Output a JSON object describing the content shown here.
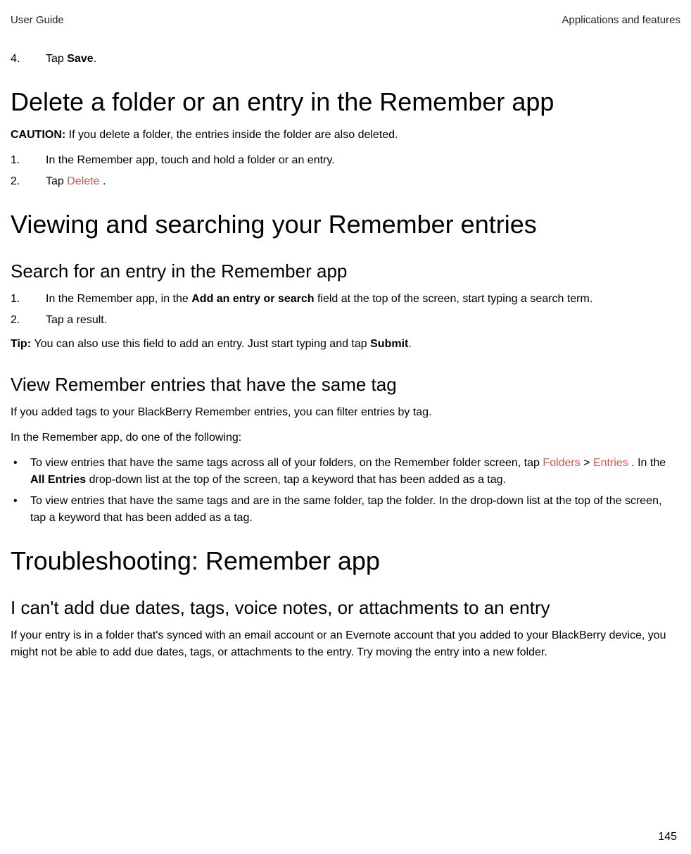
{
  "header": {
    "left": "User Guide",
    "right": "Applications and features"
  },
  "introStep": {
    "num": "4.",
    "prefix": "Tap ",
    "bold": "Save",
    "suffix": "."
  },
  "section1": {
    "h1": "Delete a folder or an entry in the Remember app",
    "cautionLabel": "CAUTION: ",
    "cautionText": "If you delete a folder, the entries inside the folder are also deleted.",
    "steps": [
      {
        "num": "1.",
        "text": "In the Remember app, touch and hold a folder or an entry."
      },
      {
        "num": "2.",
        "prefix": "Tap  ",
        "red": "Delete",
        "suffix": " ."
      }
    ]
  },
  "section2": {
    "h1": "Viewing and searching your Remember entries",
    "sub1": {
      "h2": "Search for an entry in the Remember app",
      "steps": [
        {
          "num": "1.",
          "pre": "In the Remember app, in the ",
          "bold": "Add an entry or search",
          "post": " field at the top of the screen, start typing a search term."
        },
        {
          "num": "2.",
          "text": "Tap a result."
        }
      ],
      "tipLabel": "Tip: ",
      "tipPre": "You can also use this field to add an entry. Just start typing and tap ",
      "tipBold": "Submit",
      "tipPost": "."
    },
    "sub2": {
      "h2": "View Remember entries that have the same tag",
      "p1": "If you added tags to your BlackBerry Remember entries, you can filter entries by tag.",
      "p2": "In the Remember app, do one of the following:",
      "bullets": [
        {
          "pre": "To view entries that have the same tags across all of your folders, on the Remember folder screen, tap  ",
          "red1": "Folders",
          "mid": "  > ",
          "red2": "Entries",
          "post1": " . In the ",
          "bold": "All Entries",
          "post2": " drop-down list at the top of the screen, tap a keyword that has been added as a tag."
        },
        {
          "text": "To view entries that have the same tags and are in the same folder, tap the folder. In the drop-down list at the top of the screen, tap a keyword that has been added as a tag."
        }
      ]
    }
  },
  "section3": {
    "h1": "Troubleshooting: Remember app",
    "sub": {
      "h2": "I can't add due dates, tags, voice notes, or attachments to an entry",
      "p": "If your entry is in a folder that's synced with an email account or an Evernote account that you added to your BlackBerry device, you might not be able to add due dates, tags, or attachments to the entry. Try moving the entry into a new folder."
    }
  },
  "pageNumber": "145"
}
